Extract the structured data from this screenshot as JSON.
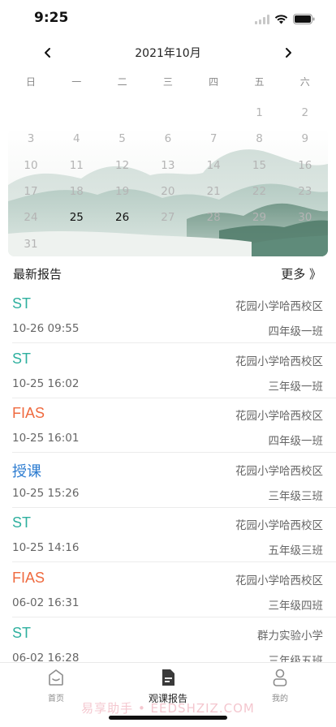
{
  "status": {
    "time": "9:25"
  },
  "calendar": {
    "month_title": "2021年10月",
    "weekdays": [
      "日",
      "一",
      "二",
      "三",
      "四",
      "五",
      "六"
    ],
    "weeks": [
      [
        "",
        "",
        "",
        "",
        "",
        "1",
        "2"
      ],
      [
        "3",
        "4",
        "5",
        "6",
        "7",
        "8",
        "9"
      ],
      [
        "10",
        "11",
        "12",
        "13",
        "14",
        "15",
        "16"
      ],
      [
        "17",
        "18",
        "19",
        "20",
        "21",
        "22",
        "23"
      ],
      [
        "24",
        "25",
        "26",
        "27",
        "28",
        "29",
        "30"
      ],
      [
        "31",
        "",
        "",
        "",
        "",
        "",
        ""
      ]
    ],
    "active_days": [
      "25",
      "26"
    ]
  },
  "section": {
    "title": "最新报告",
    "more": "更多 》"
  },
  "reports": [
    {
      "type": "ST",
      "color": "#2fb09f",
      "school": "花园小学哈西校区",
      "time": "10-26 09:55",
      "class": "四年级一班"
    },
    {
      "type": "ST",
      "color": "#2fb09f",
      "school": "花园小学哈西校区",
      "time": "10-25 16:02",
      "class": "三年级一班"
    },
    {
      "type": "FIAS",
      "color": "#ef6a3f",
      "school": "花园小学哈西校区",
      "time": "10-25 16:01",
      "class": "四年级一班"
    },
    {
      "type": "授课",
      "color": "#2b7bd0",
      "school": "花园小学哈西校区",
      "time": "10-25 15:26",
      "class": "三年级三班"
    },
    {
      "type": "ST",
      "color": "#2fb09f",
      "school": "花园小学哈西校区",
      "time": "10-25 14:16",
      "class": "五年级三班"
    },
    {
      "type": "FIAS",
      "color": "#ef6a3f",
      "school": "花园小学哈西校区",
      "time": "06-02 16:31",
      "class": "三年级四班"
    },
    {
      "type": "ST",
      "color": "#2fb09f",
      "school": "群力实验小学",
      "time": "06-02 16:28",
      "class": "三年级五班"
    }
  ],
  "tabs": [
    {
      "label": "首页",
      "icon": "home-icon",
      "active": false
    },
    {
      "label": "观课报告",
      "icon": "report-icon",
      "active": true
    },
    {
      "label": "我的",
      "icon": "profile-icon",
      "active": false
    }
  ],
  "watermark": "易享助手 • EEDSHZIZ.COM"
}
